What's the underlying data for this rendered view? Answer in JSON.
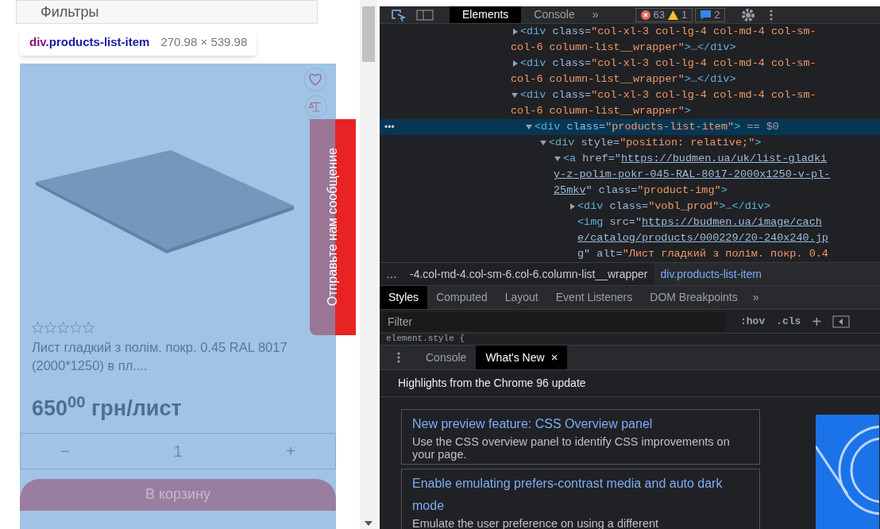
{
  "page": {
    "filter_label": "Фильтры",
    "tooltip": {
      "tag": "div",
      "class_name": ".products-list-item",
      "size": "270.98 × 539.98"
    },
    "product": {
      "stars": 0,
      "title": "Лист гладкий з полім. покр. 0.45 RAL 8017 (2000*1250) в пл....",
      "price": "650$^{00}$ грн/лист",
      "quantity": {
        "minus": "−",
        "value": "1",
        "plus": "+"
      },
      "cart_button": "В корзину"
    },
    "feedback_tab": "Отправьте нам сообщение"
  },
  "devtools": {
    "toolbar": {
      "tabs": [
        {
          "label": "Elements",
          "selected": true
        },
        {
          "label": "Console",
          "selected": false
        }
      ],
      "more": "»",
      "errors": "63",
      "warnings": "1",
      "messages": "2"
    },
    "tree": [
      {
        "expanded": false,
        "selected": false,
        "lines": [
          [
            {
              "kind": "tag",
              "t": "<div"
            },
            {
              "kind": "attr",
              "t": " class="
            },
            {
              "kind": "val",
              "t": "\"col-xl-3 col-lg-4 col-md-4 col-sm-"
            }
          ],
          [
            {
              "kind": "val",
              "t": "col-6 column-list__wrapper\""
            },
            {
              "kind": "tag",
              "t": ">…</div>"
            }
          ]
        ]
      },
      {
        "expanded": false,
        "selected": false,
        "lines": [
          [
            {
              "kind": "tag",
              "t": "<div"
            },
            {
              "kind": "attr",
              "t": " class="
            },
            {
              "kind": "val",
              "t": "\"col-xl-3 col-lg-4 col-md-4 col-sm-"
            }
          ],
          [
            {
              "kind": "val",
              "t": "col-6 column-list__wrapper\""
            },
            {
              "kind": "tag",
              "t": ">…</div>"
            }
          ]
        ]
      },
      {
        "expanded": true,
        "selected": false,
        "lines": [
          [
            {
              "kind": "tag",
              "t": "<div"
            },
            {
              "kind": "attr",
              "t": " class="
            },
            {
              "kind": "val",
              "t": "\"col-xl-3 col-lg-4 col-md-4 col-sm-"
            }
          ],
          [
            {
              "kind": "val",
              "t": "col-6 column-list__wrapper\""
            },
            {
              "kind": "tag",
              "t": ">"
            }
          ]
        ],
        "children": [
          {
            "expanded": true,
            "selected": true,
            "marker": "•••",
            "lines": [
              [
                {
                  "kind": "tag",
                  "t": "<div"
                },
                {
                  "kind": "attr",
                  "t": " class="
                },
                {
                  "kind": "val",
                  "t": "\"products-list-item\""
                },
                {
                  "kind": "tag",
                  "t": ">"
                },
                {
                  "kind": "eq",
                  "t": " == $0"
                }
              ]
            ],
            "children": [
              {
                "expanded": true,
                "selected": false,
                "lines": [
                  [
                    {
                      "kind": "tag",
                      "t": "<div"
                    },
                    {
                      "kind": "attr",
                      "t": " style="
                    },
                    {
                      "kind": "val",
                      "t": "\"position: relative;\""
                    },
                    {
                      "kind": "tag",
                      "t": ">"
                    }
                  ]
                ],
                "children": [
                  {
                    "expanded": true,
                    "selected": false,
                    "lines": [
                      [
                        {
                          "kind": "tag",
                          "t": "<a"
                        },
                        {
                          "kind": "attr",
                          "t": " href=\""
                        },
                        {
                          "kind": "link",
                          "t": "https://budmen.ua/uk/list-gladki"
                        }
                      ],
                      [
                        {
                          "kind": "link",
                          "t": "y-z-polim-pokr-045-RAL-8017-2000x1250-v-pl-"
                        }
                      ],
                      [
                        {
                          "kind": "link",
                          "t": "25mkv"
                        },
                        {
                          "kind": "attr",
                          "t": "\" class="
                        },
                        {
                          "kind": "val",
                          "t": "\"product-img\""
                        },
                        {
                          "kind": "tag",
                          "t": ">"
                        }
                      ]
                    ],
                    "children": [
                      {
                        "expanded": false,
                        "selected": false,
                        "lines": [
                          [
                            {
                              "kind": "tag",
                              "t": "<div"
                            },
                            {
                              "kind": "attr",
                              "t": " class="
                            },
                            {
                              "kind": "val",
                              "t": "\"vobl_prod\""
                            },
                            {
                              "kind": "tag",
                              "t": ">…</div>"
                            }
                          ]
                        ]
                      },
                      {
                        "selected": false,
                        "lines": [
                          [
                            {
                              "kind": "tag",
                              "t": "<img"
                            },
                            {
                              "kind": "attr",
                              "t": " src=\""
                            },
                            {
                              "kind": "link",
                              "t": "https://budmen.ua/image/cach"
                            }
                          ],
                          [
                            {
                              "kind": "link",
                              "t": "e/catalog/products/000229/20-240x240.jp"
                            }
                          ],
                          [
                            {
                              "kind": "link",
                              "t": "g"
                            },
                            {
                              "kind": "attr",
                              "t": "\" alt="
                            },
                            {
                              "kind": "val",
                              "t": "\"Лист гладкий з полім. покр. 0.4"
                            }
                          ]
                        ]
                      }
                    ]
                  }
                ]
              }
            ]
          }
        ]
      }
    ],
    "breadcrumbs": [
      {
        "label": "…",
        "selected": false
      },
      {
        "label": "-4.col-md-4.col-sm-6.col-6.column-list__wrapper",
        "selected": false
      },
      {
        "label": "div.products-list-item",
        "selected": true
      }
    ],
    "style_tabs": [
      {
        "label": "Styles",
        "selected": true
      },
      {
        "label": "Computed",
        "selected": false
      },
      {
        "label": "Layout",
        "selected": false
      },
      {
        "label": "Event Listeners",
        "selected": false
      },
      {
        "label": "DOM Breakpoints",
        "selected": false
      }
    ],
    "style_more": "»",
    "filter": {
      "placeholder": "Filter",
      "hov": ":hov",
      "cls": ".cls",
      "add": "+"
    },
    "element_style": "element.style {",
    "drawer_tabs": [
      {
        "label": "Console",
        "selected": false
      },
      {
        "label": "What's New",
        "selected": true,
        "close": "×"
      }
    ],
    "whats_new": {
      "heading": "Highlights from the Chrome 96 update",
      "cards": [
        {
          "title": "New preview feature: CSS Overview panel",
          "text": "Use the CSS overview panel to identify CSS improvements on your page."
        },
        {
          "title": "Enable emulating prefers-contrast media and auto dark mode",
          "text": "Emulate the user preference on using a different"
        }
      ]
    }
  }
}
